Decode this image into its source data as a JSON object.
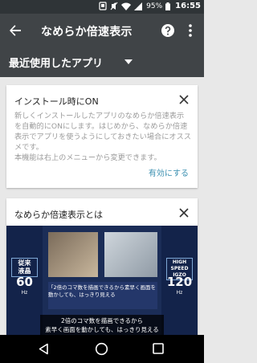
{
  "status_bar": {
    "battery_percent": "95%",
    "time": "16:55"
  },
  "app_bar": {
    "title": "なめらか倍速表示",
    "back_icon": "arrow-back-icon",
    "help_icon": "help-icon",
    "more_icon": "more-vert-icon"
  },
  "filter": {
    "label": "最近使用したアプリ",
    "dropdown_icon": "caret-down-icon"
  },
  "cards": [
    {
      "title": "インストール時にON",
      "body": [
        "新しくインストールしたアプリのなめらか倍速表示を自動的にONにします。はじめから、なめらか倍速表示でアプリを使うようにしておきたい場合にオススメです。",
        "本機能は右上のメニューから変更できます。"
      ],
      "action": "有効にする"
    },
    {
      "title": "なめらか倍速表示とは",
      "media": {
        "left_label": "従来\n液晶",
        "left_value": "60",
        "left_unit": "Hz",
        "right_label": "HIGH\nSPEED\nIGZO",
        "right_value": "120",
        "right_unit": "Hz",
        "caption1": "「2倍のコマ数を描画できるから素早く画面を動かしても、はっきり見える",
        "subtitle": "2倍のコマ数を描画できるから\n素早く画面を動かしても、はっきり見える"
      }
    }
  ],
  "colors": {
    "status_bar": "#2f3437",
    "app_bar": "#404447",
    "accent": "#3a8fb0",
    "background": "#e8e8e8"
  }
}
